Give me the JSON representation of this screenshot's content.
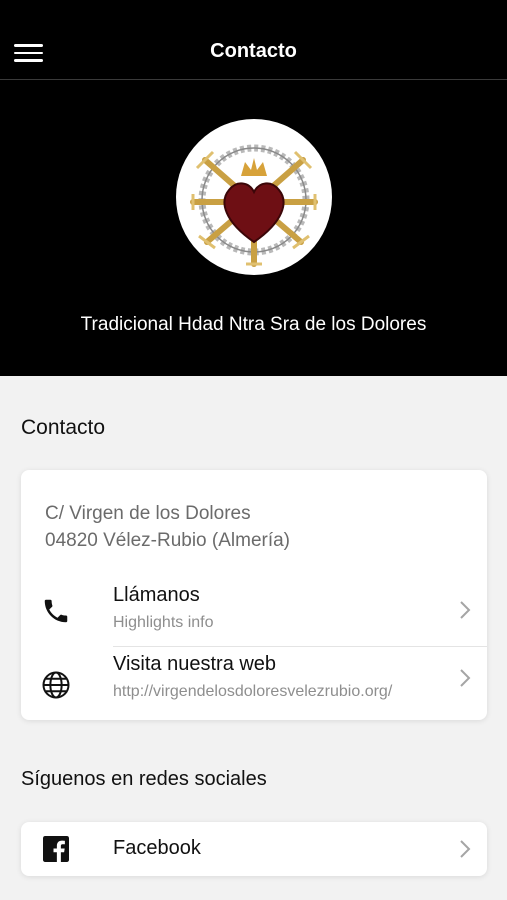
{
  "header": {
    "title": "Contacto",
    "menu_icon": "hamburger-menu-icon"
  },
  "hero": {
    "org_name": "Tradicional Hdad Ntra Sra de los Dolores",
    "logo": "sacred-heart-crest-logo"
  },
  "contact": {
    "section_title": "Contacto",
    "address_line1": "C/ Virgen de los Dolores",
    "address_line2": "04820 Vélez-Rubio (Almería)",
    "call": {
      "label": "Llámanos",
      "sub": "Highlights info",
      "icon": "phone-icon"
    },
    "web": {
      "label": "Visita nuestra web",
      "sub": "http://virgendelosdoloresvelezrubio.org/",
      "icon": "globe-icon"
    }
  },
  "social": {
    "section_title": "Síguenos en redes sociales",
    "facebook": {
      "label": "Facebook",
      "icon": "facebook-icon"
    }
  },
  "colors": {
    "header_bg": "#000000",
    "page_bg": "#f2f2f2",
    "card_bg": "#ffffff",
    "muted_text": "#8e8e8e"
  }
}
